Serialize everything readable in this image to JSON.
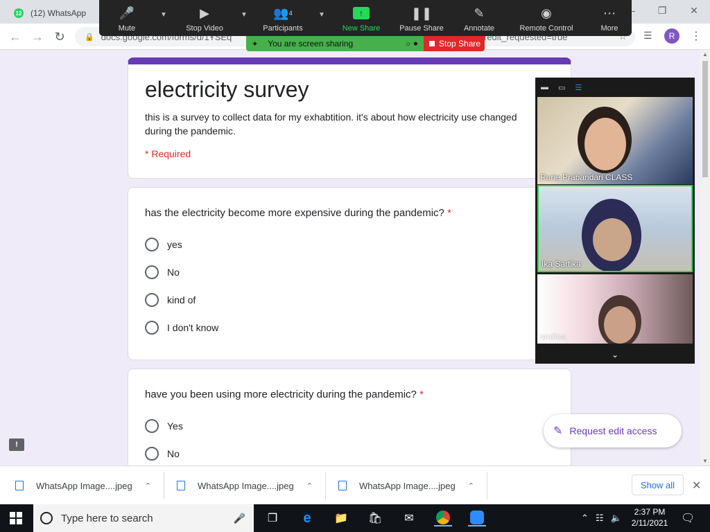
{
  "browser": {
    "tab_badge": "12",
    "tab_title": "(12) WhatsApp",
    "url_visible": "docs.google.com/forms/d/1ŦSEq",
    "url_tail": "redit_requested=true",
    "profile_initial": "R"
  },
  "zoom_toolbar": {
    "mute": "Mute",
    "stop_video": "Stop Video",
    "participants": "Participants",
    "participant_count": "4",
    "new_share": "New Share",
    "pause_share": "Pause Share",
    "annotate": "Annotate",
    "remote_control": "Remote Control",
    "more": "More"
  },
  "share_banner": {
    "text": "You are screen sharing",
    "stop": "Stop Share"
  },
  "form": {
    "title": "electricity survey",
    "description": "this is a survey to collect data for my exhabtition. it's about how electricity use changed during the pandemic.",
    "required_note": "* Required",
    "questions": [
      {
        "title": "has the electricity become more expensive during the pandemic?",
        "required": "*",
        "options": [
          "yes",
          "No",
          "kind of",
          "I don't know"
        ]
      },
      {
        "title": "have you been using more electricity during the pandemic?",
        "required": "*",
        "options": [
          "Yes",
          "No"
        ]
      }
    ],
    "edit_access": "Request edit access",
    "feedback": "!"
  },
  "video_panel": {
    "participants": [
      "Rurie Prabandari CLASS",
      "Ika Sartika",
      "andhra"
    ]
  },
  "downloads": {
    "files": [
      "WhatsApp Image....jpeg",
      "WhatsApp Image....jpeg",
      "WhatsApp Image....jpeg"
    ],
    "show_all": "Show all"
  },
  "taskbar": {
    "search_placeholder": "Type here to search",
    "time": "2:37 PM",
    "date": "2/11/2021"
  },
  "colors": {
    "form_accent": "#673ab7",
    "required": "#d93025",
    "zoom_green": "#23d959",
    "stop_red": "#e02828"
  }
}
